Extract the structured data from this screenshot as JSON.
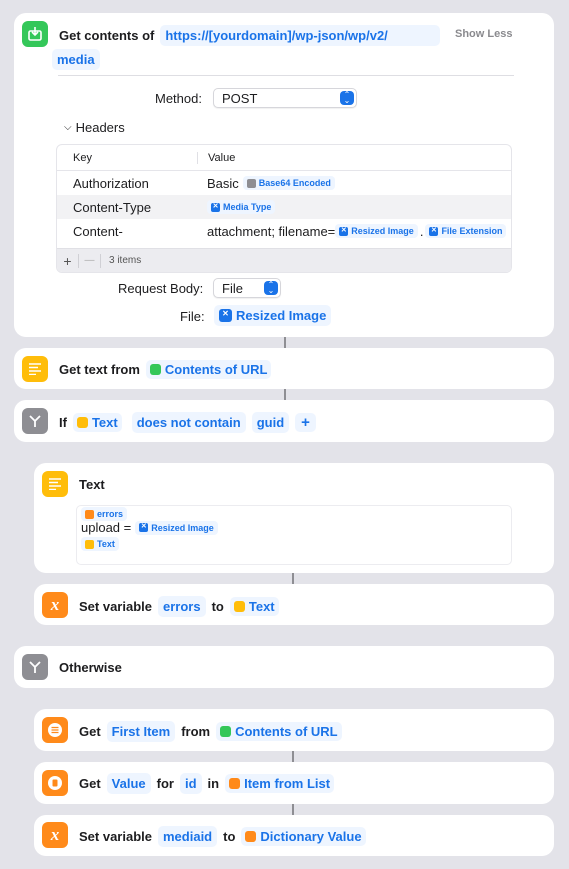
{
  "steps": {
    "get_contents": {
      "prefix": "Get contents of",
      "url_line1": "https://[yourdomain]/wp-json/wp/v2/",
      "url_line2": "media",
      "toggle": "Show Less",
      "method_label": "Method:",
      "method_value": "POST",
      "headers_label": "Headers",
      "headers_columns": [
        "Key",
        "Value"
      ],
      "headers": [
        {
          "key": "Authorization",
          "value_text": "Basic",
          "token": "Base64 Encoded"
        },
        {
          "key": "Content-Type",
          "value_text": "",
          "token": "Media Type"
        },
        {
          "key": "Content-",
          "value_text": "attachment; filename=",
          "token": "Resized Image",
          "separator": ".",
          "token2": "File Extension"
        }
      ],
      "headers_count": "3 items",
      "add_label": "+",
      "remove_label": "—",
      "body_label": "Request Body:",
      "body_value": "File",
      "file_label": "File:",
      "file_value": "Resized Image"
    },
    "get_text": {
      "prefix": "Get text from",
      "source": "Contents of URL"
    },
    "if": {
      "prefix": "If",
      "input": "Text",
      "condition": "does not contain",
      "value": "guid",
      "add": "+"
    },
    "text": {
      "title": "Text",
      "var_errors": "errors",
      "line": "upload =",
      "var_resized": "Resized Image",
      "var_text": "Text"
    },
    "set_errors": {
      "prefix": "Set variable",
      "name": "errors",
      "to": "to",
      "value": "Text"
    },
    "otherwise": {
      "label": "Otherwise"
    },
    "get_item": {
      "prefix": "Get",
      "which": "First Item",
      "from": "from",
      "source": "Contents of URL"
    },
    "get_value": {
      "prefix": "Get",
      "what": "Value",
      "for": "for",
      "key": "id",
      "in": "in",
      "source": "Item from List"
    },
    "set_mediaid": {
      "prefix": "Set variable",
      "name": "mediaid",
      "to": "to",
      "value": "Dictionary Value"
    }
  },
  "colors": {
    "accent": "#1a73e8",
    "background": "#e3e3e9",
    "web_green": "#34c759",
    "text_yellow": "#ffbd0a",
    "scripting_orange": "#ff8a1a",
    "control_gray": "#8e8e93"
  }
}
